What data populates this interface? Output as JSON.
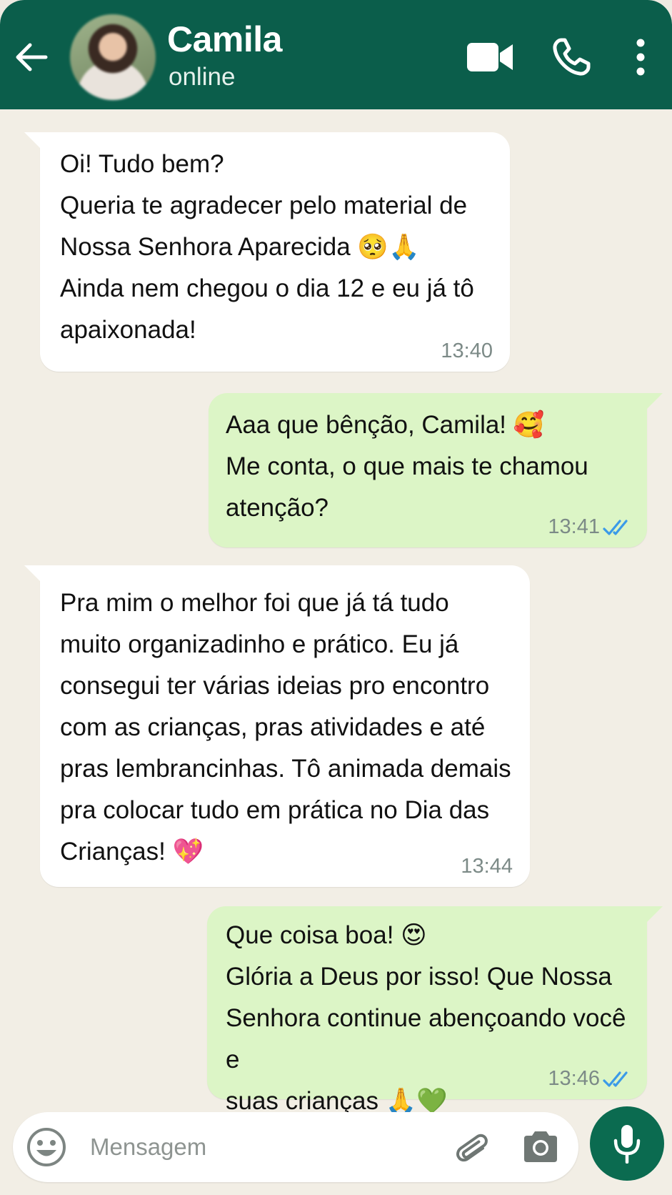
{
  "header": {
    "contact_name": "Camila",
    "status": "online",
    "icons": [
      "back-arrow-icon",
      "video-call-icon",
      "phone-icon",
      "more-options-icon"
    ],
    "background_color": "#0b5e4b"
  },
  "messages": [
    {
      "direction": "incoming",
      "text": "Oi! Tudo bem?\nQueria te agradecer pelo material de\nNossa Senhora Aparecida 🥺🙏\nAinda nem chegou o dia 12 e eu já tô\napaixonada!",
      "time": "13:40"
    },
    {
      "direction": "outgoing",
      "text": "Aaa que bênção, Camila! 🥰\nMe conta, o que mais te chamou\natenção?",
      "time": "13:41",
      "read": true
    },
    {
      "direction": "incoming",
      "text": "Pra mim o melhor foi que já tá tudo\nmuito organizadinho e prático. Eu já\nconsegui ter várias ideias pro encontro\ncom as crianças, pras atividades e até\npras lembrancinhas. Tô animada demais\npra colocar tudo em prática no Dia das\nCrianças! 💖",
      "time": "13:44"
    },
    {
      "direction": "outgoing",
      "text": "Que coisa boa! 😍\nGlória a Deus por isso! Que Nossa\nSenhora continue abençoando você e\nsuas crianças 🙏💚",
      "time": "13:46",
      "read": true
    }
  ],
  "composer": {
    "placeholder": "Mensagem",
    "icons": [
      "emoji-icon",
      "attach-icon",
      "camera-icon",
      "mic-icon"
    ],
    "accent_color": "#0b6b50"
  },
  "colors": {
    "incoming_bubble": "#ffffff",
    "outgoing_bubble": "#dcf5c6",
    "read_ticks": "#3b9ae8"
  }
}
